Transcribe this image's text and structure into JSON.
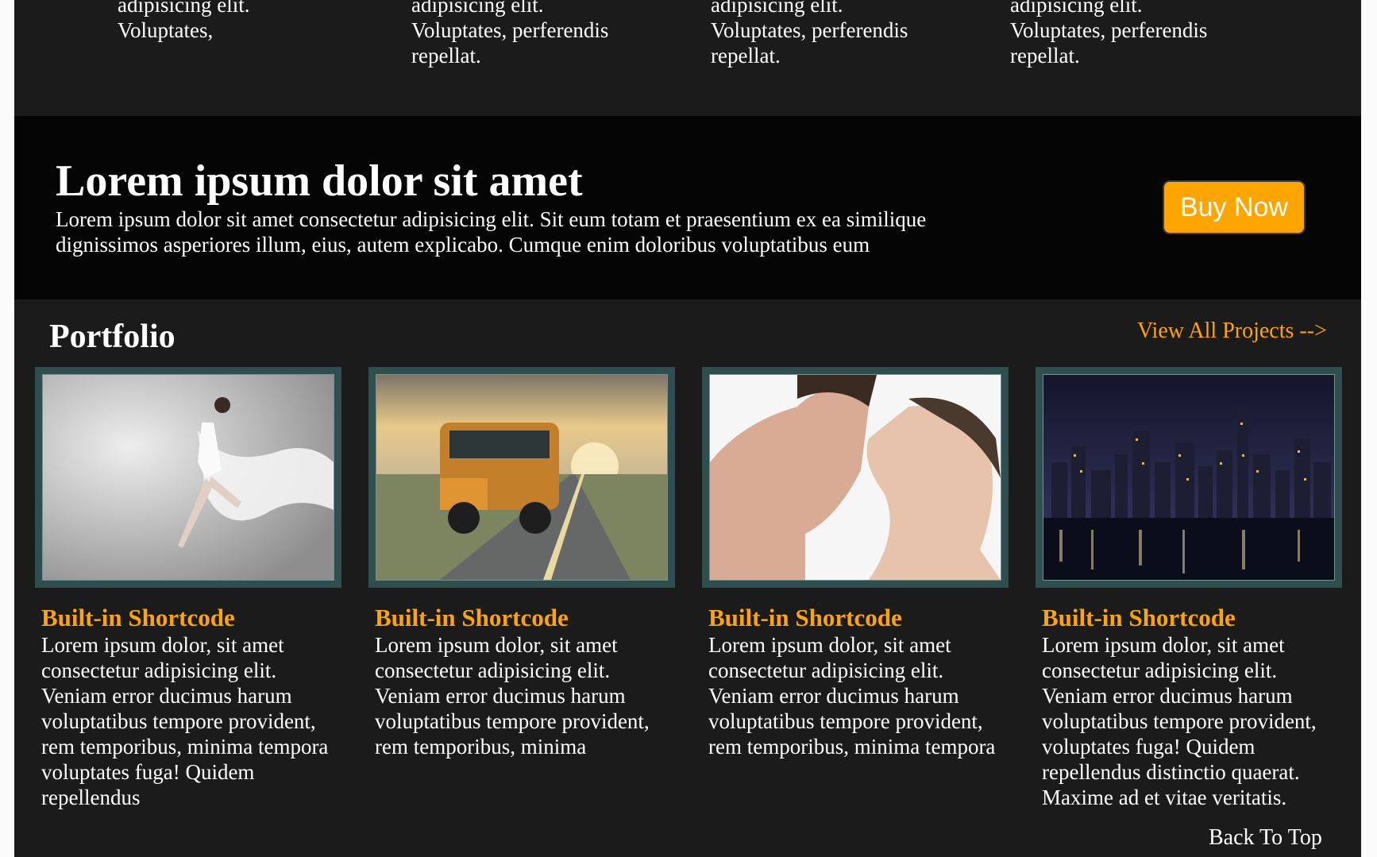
{
  "features": [
    {
      "lines": [
        "adipisicing elit.",
        "Voluptates,"
      ]
    },
    {
      "lines": [
        "adipisicing elit.",
        "Voluptates, perferendis",
        "repellat."
      ]
    },
    {
      "lines": [
        "adipisicing elit.",
        "Voluptates, perferendis",
        "repellat."
      ]
    },
    {
      "lines": [
        "adipisicing elit.",
        "Voluptates, perferendis",
        "repellat."
      ]
    }
  ],
  "promo": {
    "title": "Lorem ipsum dolor sit amet",
    "text": "Lorem ipsum dolor sit amet consectetur adipisicing elit. Sit eum totam et praesentium ex ea similique dignissimos asperiores illum, eius, autem explicabo. Cumque enim doloribus voluptatibus eum",
    "button": "Buy Now"
  },
  "portfolio": {
    "title": "Portfolio",
    "view_all": "View All Projects -->",
    "items": [
      {
        "image": "dancer-image",
        "title": "Built-in Shortcode",
        "text": "Lorem ipsum dolor, sit amet consectetur adipisicing elit. Veniam error ducimus harum voluptatibus tempore provident, rem temporibus, minima tempora voluptates fuga! Quidem repellendus"
      },
      {
        "image": "bus-image",
        "title": "Built-in Shortcode",
        "text": "Lorem ipsum dolor, sit amet consectetur adipisicing elit. Veniam error ducimus harum voluptatibus tempore provident, rem temporibus, minima"
      },
      {
        "image": "couple-image",
        "title": "Built-in Shortcode",
        "text": "Lorem ipsum dolor, sit amet consectetur adipisicing elit. Veniam error ducimus harum voluptatibus tempore provident, rem temporibus, minima tempora"
      },
      {
        "image": "city-night-image",
        "title": "Built-in Shortcode",
        "text": "Lorem ipsum dolor, sit amet consectetur adipisicing elit. Veniam error ducimus harum voluptatibus tempore provident, voluptates fuga! Quidem repellendus distinctio quaerat. Maxime ad et vitae veritatis."
      }
    ]
  },
  "back_to_top": "Back To Top",
  "colors": {
    "accent": "#ffa500",
    "background": "#1b1b1b",
    "banner": "#050505",
    "frame": "#2f4f4f"
  }
}
